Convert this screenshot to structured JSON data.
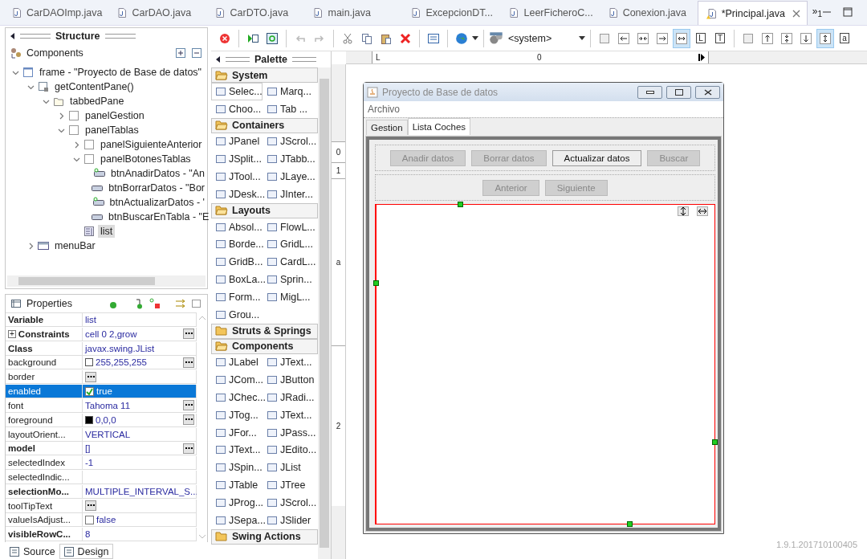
{
  "editor_tabs": [
    {
      "label": "CarDAOImp.java",
      "selected": false,
      "warning": false
    },
    {
      "label": "CarDAO.java",
      "selected": false,
      "warning": false
    },
    {
      "label": "CarDTO.java",
      "selected": false,
      "warning": false
    },
    {
      "label": "main.java",
      "selected": false,
      "warning": false
    },
    {
      "label": "ExcepcionDT...",
      "selected": false,
      "warning": false
    },
    {
      "label": "LeerFicheroC...",
      "selected": false,
      "warning": false
    },
    {
      "label": "Conexion.java",
      "selected": false,
      "warning": false
    },
    {
      "label": "*Principal.java",
      "selected": true,
      "warning": true
    }
  ],
  "overflow": "»$_{1}$",
  "structure": {
    "title": "Structure",
    "components_label": "Components",
    "tree": [
      {
        "label": "frame - \"Proyecto de Base de datos\"",
        "kind": "window",
        "expanded": true,
        "selected": false,
        "children": [
          {
            "label": "getContentPane()",
            "kind": "pane",
            "expanded": true,
            "selected": false,
            "children": [
              {
                "label": "tabbedPane",
                "kind": "folder",
                "expanded": true,
                "selected": false,
                "children": [
                  {
                    "label": "panelGestion",
                    "kind": "panel",
                    "expanded": false,
                    "selected": false
                  },
                  {
                    "label": "panelTablas",
                    "kind": "panel",
                    "expanded": true,
                    "selected": false,
                    "children": [
                      {
                        "label": "panelSiguienteAnterior",
                        "kind": "panel",
                        "expanded": false,
                        "selected": false
                      },
                      {
                        "label": "panelBotonesTablas",
                        "kind": "panel",
                        "expanded": true,
                        "selected": false,
                        "children": [
                          {
                            "label": "btnAnadirDatos - \"An",
                            "kind": "button-event",
                            "selected": false
                          },
                          {
                            "label": "btnBorrarDatos - \"Bor",
                            "kind": "button",
                            "selected": false
                          },
                          {
                            "label": "btnActualizarDatos - '",
                            "kind": "button-event",
                            "selected": false
                          },
                          {
                            "label": "btnBuscarEnTabla - \"E",
                            "kind": "button",
                            "selected": false
                          }
                        ]
                      },
                      {
                        "label": "list",
                        "kind": "list",
                        "selected": true
                      }
                    ]
                  }
                ]
              }
            ]
          },
          {
            "label": "menuBar",
            "kind": "menubar",
            "expanded": false,
            "selected": false
          }
        ]
      }
    ]
  },
  "properties": {
    "title": "Properties",
    "rows": [
      {
        "name": "Variable",
        "value": "list",
        "bold": true,
        "selected": false,
        "kind": "text",
        "more": false
      },
      {
        "name": "Constraints",
        "value": "cell 0 2,grow",
        "bold": true,
        "selected": false,
        "kind": "text",
        "more": true,
        "expander": "+"
      },
      {
        "name": "Class",
        "value": "javax.swing.JList",
        "bold": true,
        "selected": false,
        "kind": "text",
        "more": false
      },
      {
        "name": "background",
        "value": "255,255,255",
        "bold": false,
        "selected": false,
        "kind": "color",
        "color": "#ffffff",
        "more": true
      },
      {
        "name": "border",
        "bold": false,
        "selected": false,
        "kind": "text",
        "more": true
      },
      {
        "name": "enabled",
        "value": "true",
        "bold": false,
        "selected": true,
        "kind": "check",
        "checked": true,
        "more": false
      },
      {
        "name": "font",
        "value": "Tahoma 11",
        "bold": false,
        "selected": false,
        "kind": "text",
        "more": true
      },
      {
        "name": "foreground",
        "value": "0,0,0",
        "bold": false,
        "selected": false,
        "kind": "color",
        "color": "#000000",
        "more": true
      },
      {
        "name": "layoutOrient...",
        "value": "VERTICAL",
        "bold": false,
        "selected": false,
        "kind": "text",
        "more": false
      },
      {
        "name": "model",
        "value": "[]",
        "bold": true,
        "selected": false,
        "kind": "text",
        "more": true
      },
      {
        "name": "selectedIndex",
        "value": "-1",
        "bold": false,
        "selected": false,
        "kind": "text",
        "more": false
      },
      {
        "name": "selectedIndic...",
        "bold": false,
        "selected": false,
        "kind": "text",
        "more": false
      },
      {
        "name": "selectionMo...",
        "value": "MULTIPLE_INTERVAL_S...",
        "bold": true,
        "selected": false,
        "kind": "text",
        "more": false
      },
      {
        "name": "toolTipText",
        "bold": false,
        "selected": false,
        "kind": "text",
        "more": true
      },
      {
        "name": "valueIsAdjust...",
        "value": "false",
        "bold": false,
        "selected": false,
        "kind": "check",
        "checked": false,
        "more": false
      },
      {
        "name": "visibleRowC...",
        "value": "8",
        "bold": true,
        "selected": false,
        "kind": "text",
        "more": false
      }
    ]
  },
  "bottom_tabs": [
    {
      "label": "Source",
      "selected": false
    },
    {
      "label": "Design",
      "selected": true
    }
  ],
  "toolbar": {
    "undo": {
      "disabled": true
    },
    "redo": {
      "disabled": true
    },
    "look_and_feel": "<system>",
    "horizontal": [
      {
        "kind": "none",
        "selected": false
      },
      {
        "kind": "start",
        "selected": false
      },
      {
        "kind": "center",
        "selected": false
      },
      {
        "kind": "end",
        "selected": false
      },
      {
        "kind": "fill",
        "selected": true
      },
      {
        "kind": "label",
        "label": "L",
        "selected": false
      },
      {
        "kind": "label",
        "label": "T",
        "selected": false
      }
    ],
    "vertical": [
      {
        "kind": "none",
        "selected": false
      },
      {
        "kind": "start",
        "selected": false
      },
      {
        "kind": "center",
        "selected": false
      },
      {
        "kind": "end",
        "selected": false
      },
      {
        "kind": "fill",
        "selected": true
      },
      {
        "kind": "label",
        "label": "a",
        "selected": false
      }
    ]
  },
  "palette": {
    "title": "Palette",
    "groups": [
      {
        "label": "System",
        "expanded": true,
        "items": [
          {
            "label": "Selec...",
            "selected": true
          },
          {
            "label": "Marq...",
            "selected": false
          },
          {
            "label": "Choo...",
            "selected": false
          },
          {
            "label": "Tab ...",
            "selected": false
          }
        ]
      },
      {
        "label": "Containers",
        "expanded": true,
        "items": [
          {
            "label": "JPanel",
            "selected": false
          },
          {
            "label": "JScrol...",
            "selected": false
          },
          {
            "label": "JSplit...",
            "selected": false
          },
          {
            "label": "JTabb...",
            "selected": false
          },
          {
            "label": "JTool...",
            "selected": false
          },
          {
            "label": "JLaye...",
            "selected": false
          },
          {
            "label": "JDesk...",
            "selected": false
          },
          {
            "label": "JInter...",
            "selected": false
          }
        ]
      },
      {
        "label": "Layouts",
        "expanded": true,
        "items": [
          {
            "label": "Absol...",
            "selected": false
          },
          {
            "label": "FlowL...",
            "selected": false
          },
          {
            "label": "Borde...",
            "selected": false
          },
          {
            "label": "GridL...",
            "selected": false
          },
          {
            "label": "GridB...",
            "selected": false
          },
          {
            "label": "CardL...",
            "selected": false
          },
          {
            "label": "BoxLa...",
            "selected": false
          },
          {
            "label": "Sprin...",
            "selected": false
          },
          {
            "label": "Form...",
            "selected": false
          },
          {
            "label": "MigL...",
            "selected": false
          },
          {
            "label": "Grou...",
            "selected": false
          }
        ]
      },
      {
        "label": "Struts & Springs",
        "expanded": false
      },
      {
        "label": "Components",
        "expanded": true,
        "items": [
          {
            "label": "JLabel",
            "selected": false
          },
          {
            "label": "JText...",
            "selected": false
          },
          {
            "label": "JCom...",
            "selected": false
          },
          {
            "label": "JButton",
            "selected": false
          },
          {
            "label": "JChec...",
            "selected": false
          },
          {
            "label": "JRadi...",
            "selected": false
          },
          {
            "label": "JTog...",
            "selected": false
          },
          {
            "label": "JText...",
            "selected": false
          },
          {
            "label": "JFor...",
            "selected": false
          },
          {
            "label": "JPass...",
            "selected": false
          },
          {
            "label": "JText...",
            "selected": false
          },
          {
            "label": "JEdito...",
            "selected": false
          },
          {
            "label": "JSpin...",
            "selected": false
          },
          {
            "label": "JList",
            "selected": false
          },
          {
            "label": "JTable",
            "selected": false
          },
          {
            "label": "JTree",
            "selected": false
          },
          {
            "label": "JProg...",
            "selected": false
          },
          {
            "label": "JScrol...",
            "selected": false
          },
          {
            "label": "JSepa...",
            "selected": false
          },
          {
            "label": "JSlider",
            "selected": false
          }
        ]
      },
      {
        "label": "Swing Actions",
        "expanded": false
      }
    ]
  },
  "canvas": {
    "top_ruler": [
      "L",
      "0"
    ],
    "left_ruler": [
      "0",
      "1",
      "a",
      "2"
    ],
    "frame": {
      "title": "Proyecto de Base de datos",
      "menu": [
        "Archivo"
      ],
      "tabs": [
        {
          "label": "Gestion",
          "selected": false
        },
        {
          "label": "Lista Coches",
          "selected": true
        }
      ],
      "button_rows": [
        [
          {
            "label": "Anadir datos",
            "enabled": false
          },
          {
            "label": "Borrar datos",
            "enabled": false
          },
          {
            "label": "Actualizar datos",
            "enabled": true
          },
          {
            "label": "Buscar",
            "enabled": false
          }
        ],
        [
          {
            "label": "Anterior",
            "enabled": false
          },
          {
            "label": "Siguiente",
            "enabled": false
          }
        ]
      ],
      "list": {
        "selected": true
      }
    },
    "version": "1.9.1.201710100405"
  }
}
